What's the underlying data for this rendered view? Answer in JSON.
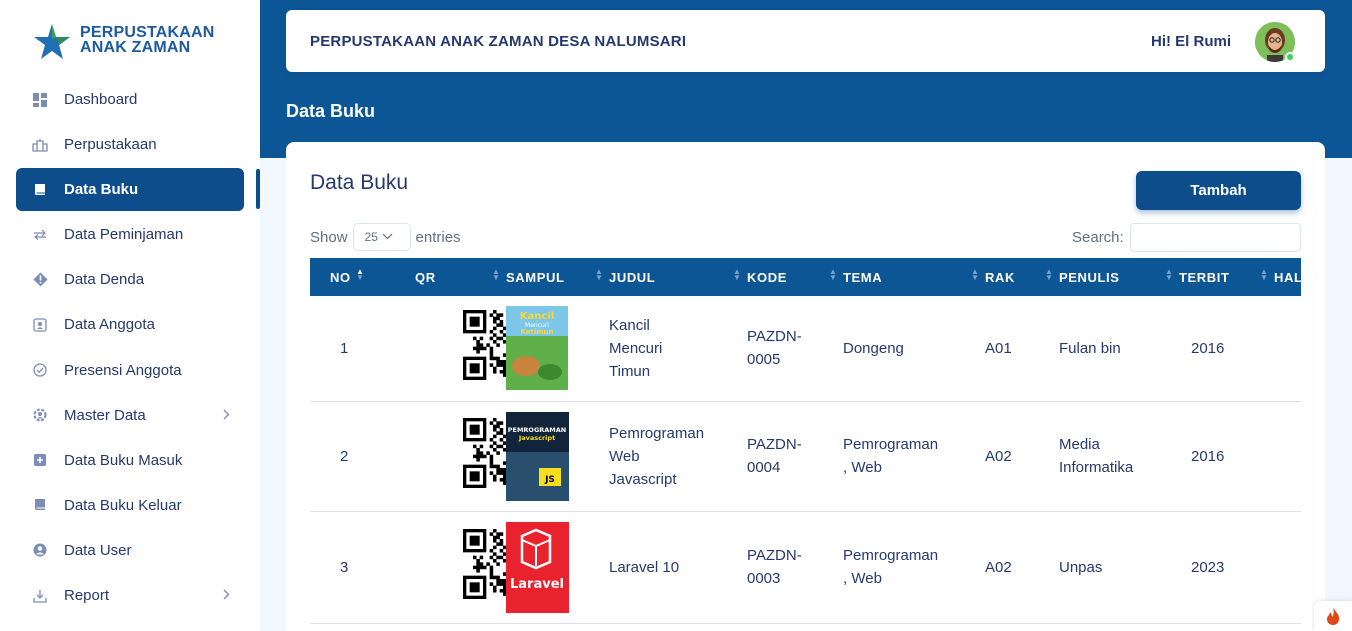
{
  "brand": {
    "line1": "PERPUSTAKAAN",
    "line2": "ANAK ZAMAN"
  },
  "sidebar": {
    "items": [
      {
        "label": "Dashboard",
        "icon": "grid-icon"
      },
      {
        "label": "Perpustakaan",
        "icon": "building-icon"
      },
      {
        "label": "Data Buku",
        "icon": "book-icon",
        "active": true
      },
      {
        "label": "Data Peminjaman",
        "icon": "arrows-icon"
      },
      {
        "label": "Data Denda",
        "icon": "diamond-alert-icon"
      },
      {
        "label": "Data Anggota",
        "icon": "member-card-icon"
      },
      {
        "label": "Presensi Anggota",
        "icon": "check-circle-icon"
      },
      {
        "label": "Master Data",
        "icon": "gear-person-icon",
        "submenu": true
      },
      {
        "label": "Data Buku Masuk",
        "icon": "plus-box-icon"
      },
      {
        "label": "Data Buku Keluar",
        "icon": "book-out-icon"
      },
      {
        "label": "Data User",
        "icon": "user-circle-icon"
      },
      {
        "label": "Report",
        "icon": "download-icon",
        "submenu": true
      }
    ]
  },
  "header": {
    "title": "PERPUSTAKAAN ANAK ZAMAN DESA NALUMSARI",
    "greeting": "Hi! El Rumi"
  },
  "page": {
    "heading": "Data Buku"
  },
  "card": {
    "title": "Data Buku",
    "add_button": "Tambah",
    "show_label": "Show",
    "entries_value": "25",
    "entries_label": "entries",
    "search_label": "Search:"
  },
  "table": {
    "columns": [
      "NO",
      "QR",
      "SAMPUL",
      "JUDUL",
      "KODE",
      "TEMA",
      "RAK",
      "PENULIS",
      "TERBIT",
      "HAL"
    ],
    "rows": [
      {
        "no": "1",
        "judul": [
          "Kancil",
          "Mencuri",
          "Timun"
        ],
        "kode": [
          "PAZDN-",
          "0005"
        ],
        "tema": [
          "Dongeng"
        ],
        "rak": "A01",
        "penulis": [
          "Fulan bin"
        ],
        "terbit": "2016",
        "cover_text": [
          "Kancil",
          "Mencuri",
          "Ketimun"
        ]
      },
      {
        "no": "2",
        "judul": [
          "Pemrograman",
          "Web",
          "Javascript"
        ],
        "kode": [
          "PAZDN-",
          "0004"
        ],
        "tema": [
          "Pemrograman",
          ", Web"
        ],
        "rak": "A02",
        "penulis": [
          "Media",
          "Informatika"
        ],
        "terbit": "2016",
        "cover_text": [
          "PEMROGRAMAN",
          "Javascript",
          "JS"
        ]
      },
      {
        "no": "3",
        "judul": [
          "Laravel 10"
        ],
        "kode": [
          "PAZDN-",
          "0003"
        ],
        "tema": [
          "Pemrograman",
          ", Web"
        ],
        "rak": "A02",
        "penulis": [
          "Unpas"
        ],
        "terbit": "2023",
        "cover_text": [
          "Laravel"
        ]
      }
    ]
  },
  "colors": {
    "primary": "#0d4d8c",
    "header_band": "#0d5696",
    "text": "#25396f",
    "bg": "#f2f7ff"
  }
}
